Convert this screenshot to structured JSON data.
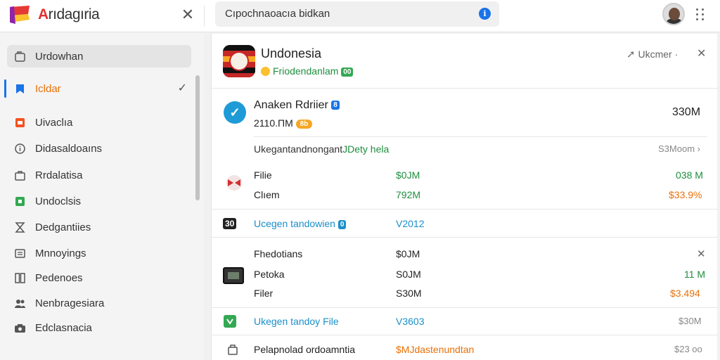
{
  "app": {
    "title_first": "A",
    "title_rest": "rıdagıria",
    "search_value": "Cıpochnaoacıa bidkan"
  },
  "sidebar": {
    "items": [
      {
        "label": "Urdowhan",
        "icon": "folder-icon"
      },
      {
        "label": "Icldar",
        "icon": "bookmark-icon",
        "selected": true
      },
      {
        "label": "Uivaclıa",
        "icon": "document-icon"
      },
      {
        "label": "Didasaldoaıns",
        "icon": "info-icon"
      },
      {
        "label": "Rrdalatisa",
        "icon": "bag-icon"
      },
      {
        "label": "Undoclsis",
        "icon": "green-square-icon"
      },
      {
        "label": "Dedgantiies",
        "icon": "hourglass-icon"
      },
      {
        "label": "Mnnoyings",
        "icon": "list-icon"
      },
      {
        "label": "Pedenoes",
        "icon": "grid-icon"
      },
      {
        "label": "Nenbragesiara",
        "icon": "people-icon"
      },
      {
        "label": "Edclasnacia",
        "icon": "camera-icon"
      }
    ]
  },
  "header": {
    "title": "Undonesia",
    "subtitle": "Friodendanlam",
    "subtitle_badge": "00",
    "action_label": "Ukcmer",
    "action_dot": "·"
  },
  "summary": {
    "name": "Anaken Rdriier",
    "name_badge": "8",
    "sub": "2110.ΠM",
    "sub_badge": "8b",
    "value": "330M",
    "link": "Ukegantandnongant",
    "link_green": "JDety hela",
    "link_right": "S3Moom"
  },
  "group1": {
    "rows": [
      {
        "label": "Filie",
        "mid": "$0JM",
        "right": "038 M",
        "right_color": "green"
      },
      {
        "label": "Clıem",
        "mid": "792M",
        "right": "$33.9%",
        "right_color": "orange"
      }
    ]
  },
  "update1": {
    "label": "Ucegen tandowien",
    "badge": "0",
    "value": "V2012"
  },
  "group2": {
    "title": "Fhedotians",
    "title_mid": "$0JM",
    "rows": [
      {
        "label": "Petoka",
        "mid": "S0JM",
        "right": "11 M",
        "right_color": "green"
      },
      {
        "label": "Filer",
        "mid": "S30M",
        "right": "$3.494",
        "right_color": "orange"
      }
    ]
  },
  "update2": {
    "label": "Ukegen tandoy File",
    "value": "V3603",
    "right": "$30M"
  },
  "footer": {
    "label": "Pelapnolad ordoamntia",
    "mid": "$MJdastenundtan",
    "right": "$23 oo"
  },
  "colors": {
    "accent": "#1a73e8",
    "positive": "#1e8e3e",
    "warning": "#e8710a",
    "link": "#1a8fc9"
  }
}
